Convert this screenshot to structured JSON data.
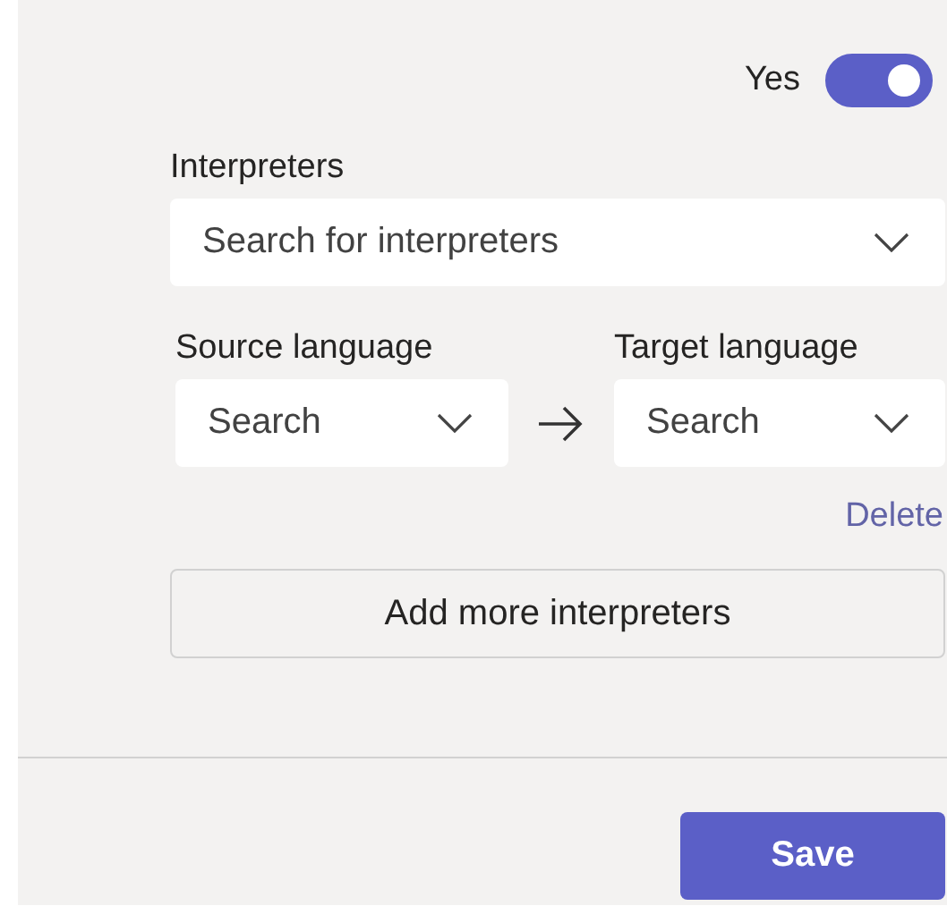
{
  "toggle": {
    "label": "Yes",
    "on": true
  },
  "interpreters": {
    "label": "Interpreters",
    "placeholder": "Search for interpreters"
  },
  "languages": [
    {
      "label": "Source language",
      "placeholder": "Search"
    },
    {
      "label": "Target language",
      "placeholder": "Search"
    }
  ],
  "delete_link": "Delete",
  "add_button": "Add more interpreters",
  "save_button": "Save"
}
